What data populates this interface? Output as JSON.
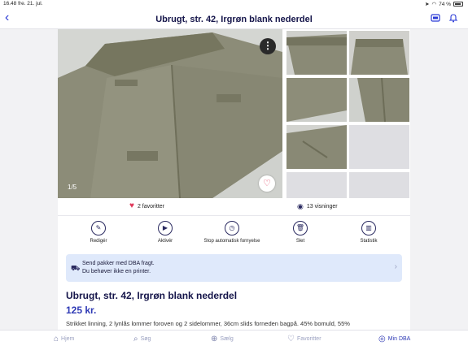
{
  "status_bar": {
    "time": "16.48",
    "date": "fre. 21. jul.",
    "battery": "74 %"
  },
  "nav": {
    "title": "Ubrugt, str. 42, Irgrøn blank nederdel"
  },
  "gallery": {
    "counter": "1/5"
  },
  "stats": {
    "favorites": "2 favoritter",
    "views": "13 visninger"
  },
  "actions": [
    {
      "label": "Redigér",
      "icon": "pencil-icon"
    },
    {
      "label": "Aktivér",
      "icon": "play-icon"
    },
    {
      "label": "Stop automatisk fornyelse",
      "icon": "timer-icon"
    },
    {
      "label": "Slet",
      "icon": "trash-icon"
    },
    {
      "label": "Statistik",
      "icon": "stats-icon"
    }
  ],
  "shipping": {
    "line1": "Send pakker med DBA fragt.",
    "line2": "Du behøver ikke en printer."
  },
  "listing": {
    "title": "Ubrugt, str. 42, Irgrøn blank nederdel",
    "price": "125 kr.",
    "description": "Strikket linning, 2 lynlås lommer foroven og 2 sidelommer, 36cm slids forneden bagpå. 45% bomuld, 55%"
  },
  "tabs": [
    {
      "label": "Hjem",
      "icon": "home-icon",
      "active": false
    },
    {
      "label": "Søg",
      "icon": "search-icon",
      "active": false
    },
    {
      "label": "Sælg",
      "icon": "sell-icon",
      "active": false
    },
    {
      "label": "Favoritter",
      "icon": "heart-icon",
      "active": false
    },
    {
      "label": "Min DBA",
      "icon": "profile-icon",
      "active": true
    }
  ],
  "colors": {
    "accent": "#2f3ab5",
    "heart": "#e0385a",
    "shipping_bg": "#dfe9fb"
  }
}
